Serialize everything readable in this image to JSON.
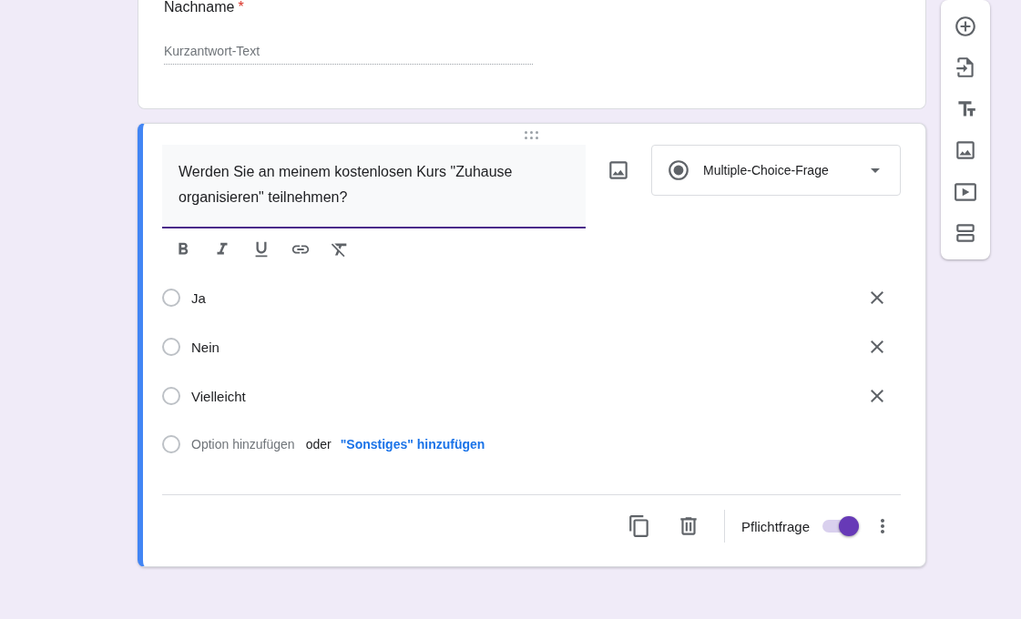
{
  "previous_question": {
    "label": "Nachname",
    "required_mark": "*",
    "placeholder": "Kurzantwort-Text"
  },
  "question": {
    "title": "Werden Sie an meinem kostenlosen Kurs \"Zuhause organisieren\" teilnehmen?",
    "type_label": "Multiple-Choice-Frage",
    "options": [
      {
        "label": "Ja",
        "selected": false
      },
      {
        "label": "Nein",
        "selected": false
      },
      {
        "label": "Vielleicht",
        "selected": false
      }
    ],
    "add_option_selected": false,
    "add_option": "Option hinzufügen",
    "or": "oder",
    "add_other": "\"Sonstiges\" hinzufügen",
    "required_label": "Pflichtfrage",
    "required": true
  }
}
